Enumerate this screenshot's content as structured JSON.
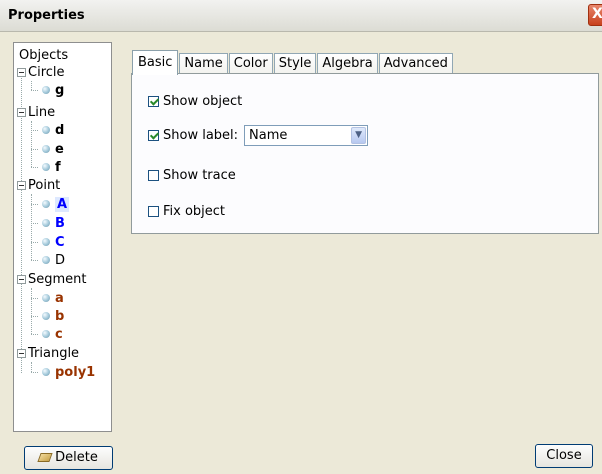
{
  "window": {
    "title": "Properties",
    "close_glyph": "X"
  },
  "tree": {
    "root_label": "Objects",
    "categories": [
      {
        "label": "Circle",
        "items": [
          {
            "label": "g",
            "color": "#000000"
          }
        ]
      },
      {
        "label": "Line",
        "items": [
          {
            "label": "d",
            "color": "#000000"
          },
          {
            "label": "e",
            "color": "#000000"
          },
          {
            "label": "f",
            "color": "#000000"
          }
        ]
      },
      {
        "label": "Point",
        "items": [
          {
            "label": "A",
            "color": "#0000ff",
            "selected": true
          },
          {
            "label": "B",
            "color": "#0000ff"
          },
          {
            "label": "C",
            "color": "#0000ff"
          },
          {
            "label": "D",
            "color": "#000000"
          }
        ]
      },
      {
        "label": "Segment",
        "items": [
          {
            "label": "a",
            "color": "#993300"
          },
          {
            "label": "b",
            "color": "#993300"
          },
          {
            "label": "c",
            "color": "#993300"
          }
        ]
      },
      {
        "label": "Triangle",
        "items": [
          {
            "label": "poly1",
            "color": "#993300"
          }
        ]
      }
    ]
  },
  "tabs": [
    "Basic",
    "Name",
    "Color",
    "Style",
    "Algebra",
    "Advanced"
  ],
  "active_tab": "Basic",
  "basic": {
    "show_object": {
      "label": "Show object",
      "checked": true
    },
    "show_label": {
      "label": "Show label:",
      "checked": true,
      "select_value": "Name"
    },
    "show_trace": {
      "label": "Show trace",
      "checked": false
    },
    "fix_object": {
      "label": "Fix object",
      "checked": false
    }
  },
  "buttons": {
    "delete": "Delete",
    "close": "Close"
  }
}
